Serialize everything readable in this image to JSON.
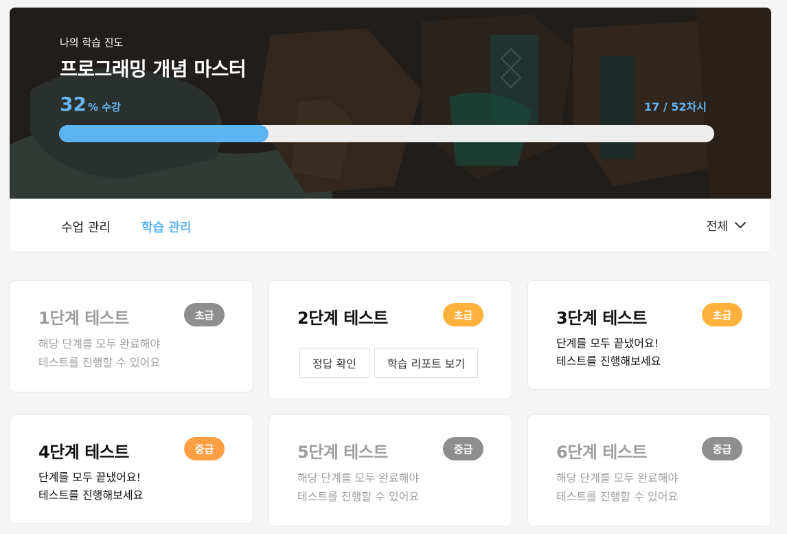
{
  "hero": {
    "subtitle": "나의 학습 진도",
    "title": "프로그래밍 개념 마스터",
    "percent": "32",
    "percent_unit": "% 수강",
    "progress_value": 0.32,
    "count": "17 / 52차시"
  },
  "tabs": {
    "class_label": "수업 관리",
    "study_label": "학습 관리"
  },
  "filter": {
    "label": "전체"
  },
  "cards": [
    {
      "title": "1단계 테스트",
      "badge": "초급",
      "line1": "해당 단계를 모두 완료해야",
      "line2": "테스트를 진행할 수 있어요"
    },
    {
      "title": "2단계 테스트",
      "badge": "초급",
      "btn_answer": "정답 확인",
      "btn_report": "학습 리포트 보기"
    },
    {
      "title": "3단계 테스트",
      "badge": "초급",
      "line1": "단계를 모두 끝냈어요!",
      "line2": "테스트를 진행해보세요"
    },
    {
      "title": "4단계 테스트",
      "badge": "중급",
      "line1": "단계를 모두 끝냈어요!",
      "line2": "테스트를 진행해보세요"
    },
    {
      "title": "5단계 테스트",
      "badge": "중급",
      "line1": "해당 단계를 모두 완료해야",
      "line2": "테스트를 진행할 수 있어요"
    },
    {
      "title": "6단계 테스트",
      "badge": "중급",
      "line1": "해당 단계를 모두 완료해야",
      "line2": "테스트를 진행할 수 있어요"
    }
  ],
  "colors": {
    "accent": "#5db4f3",
    "badge_active": "#ffb13d",
    "badge_active_mid": "#ff9f45",
    "badge_locked": "#8e8e8e"
  }
}
